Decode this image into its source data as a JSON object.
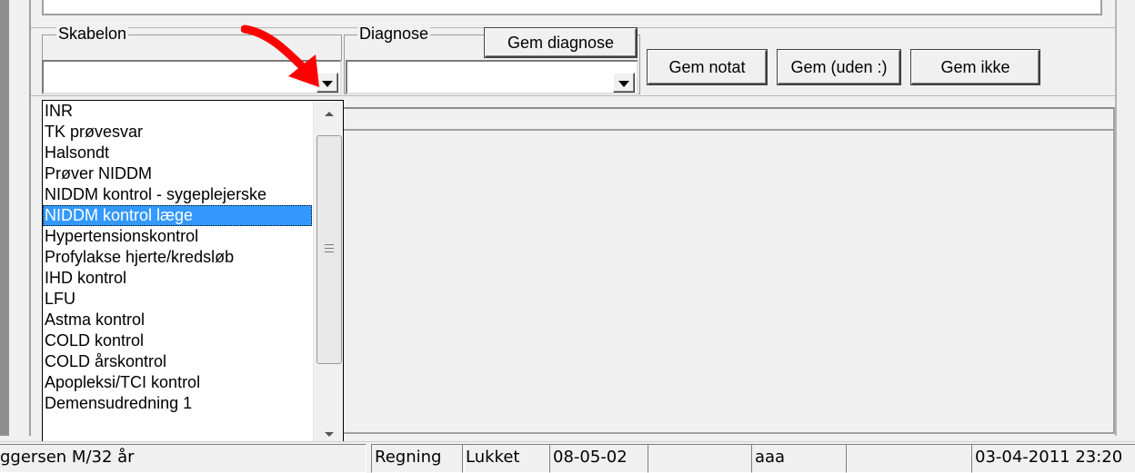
{
  "toolbar": {
    "skabelon_label": "Skabelon",
    "skabelon_value": "",
    "diagnose_label": "Diagnose",
    "diagnose_value": "",
    "gem_diagnose": "Gem diagnose",
    "gem_notat": "Gem notat",
    "gem_uden": "Gem (uden :)",
    "gem_ikke": "Gem ikke"
  },
  "dropdown": {
    "items": [
      "INR",
      "TK prøvesvar",
      "Halsondt",
      "Prøver NIDDM",
      "NIDDM kontrol - sygeplejerske",
      "NIDDM kontrol læge",
      "Hypertensionskontrol",
      "Profylakse hjerte/kredsløb",
      "IHD kontrol",
      "LFU",
      "Astma kontrol",
      "COLD kontrol",
      "COLD årskontrol",
      "Apopleksi/TCI kontrol",
      "Demensudredning 1"
    ],
    "selected_index": 5
  },
  "statusbar": {
    "patient": "ggersen M/32 år",
    "regning": "Regning",
    "lukket": "Lukket",
    "date": "08-05-02",
    "user": "aaa",
    "datetime": "03-04-2011 23:20"
  },
  "colors": {
    "selection": "#3399ff",
    "annotation_arrow": "#ff0000"
  }
}
